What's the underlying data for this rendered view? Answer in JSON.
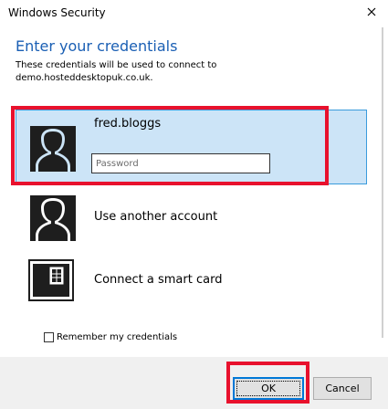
{
  "window": {
    "title": "Windows Security",
    "close_icon": "close-icon"
  },
  "header": {
    "heading": "Enter your credentials",
    "description": "These credentials will be used to connect to demo.hosteddesktopuk.co.uk."
  },
  "account": {
    "username": "fred.bloggs",
    "password_placeholder": "Password",
    "password_value": "",
    "icon": "user-icon"
  },
  "options": [
    {
      "label": "Use another account",
      "icon": "user-icon"
    },
    {
      "label": "Connect a smart card",
      "icon": "smart-card-icon"
    }
  ],
  "remember": {
    "label": "Remember my credentials",
    "checked": false
  },
  "buttons": {
    "ok": "OK",
    "cancel": "Cancel"
  },
  "colors": {
    "accent": "#1a5fb4",
    "selection_bg": "#cce4f7",
    "selection_border": "#3a9bdc",
    "highlight_red": "#e8112d",
    "footer_bg": "#f0f0f0"
  }
}
